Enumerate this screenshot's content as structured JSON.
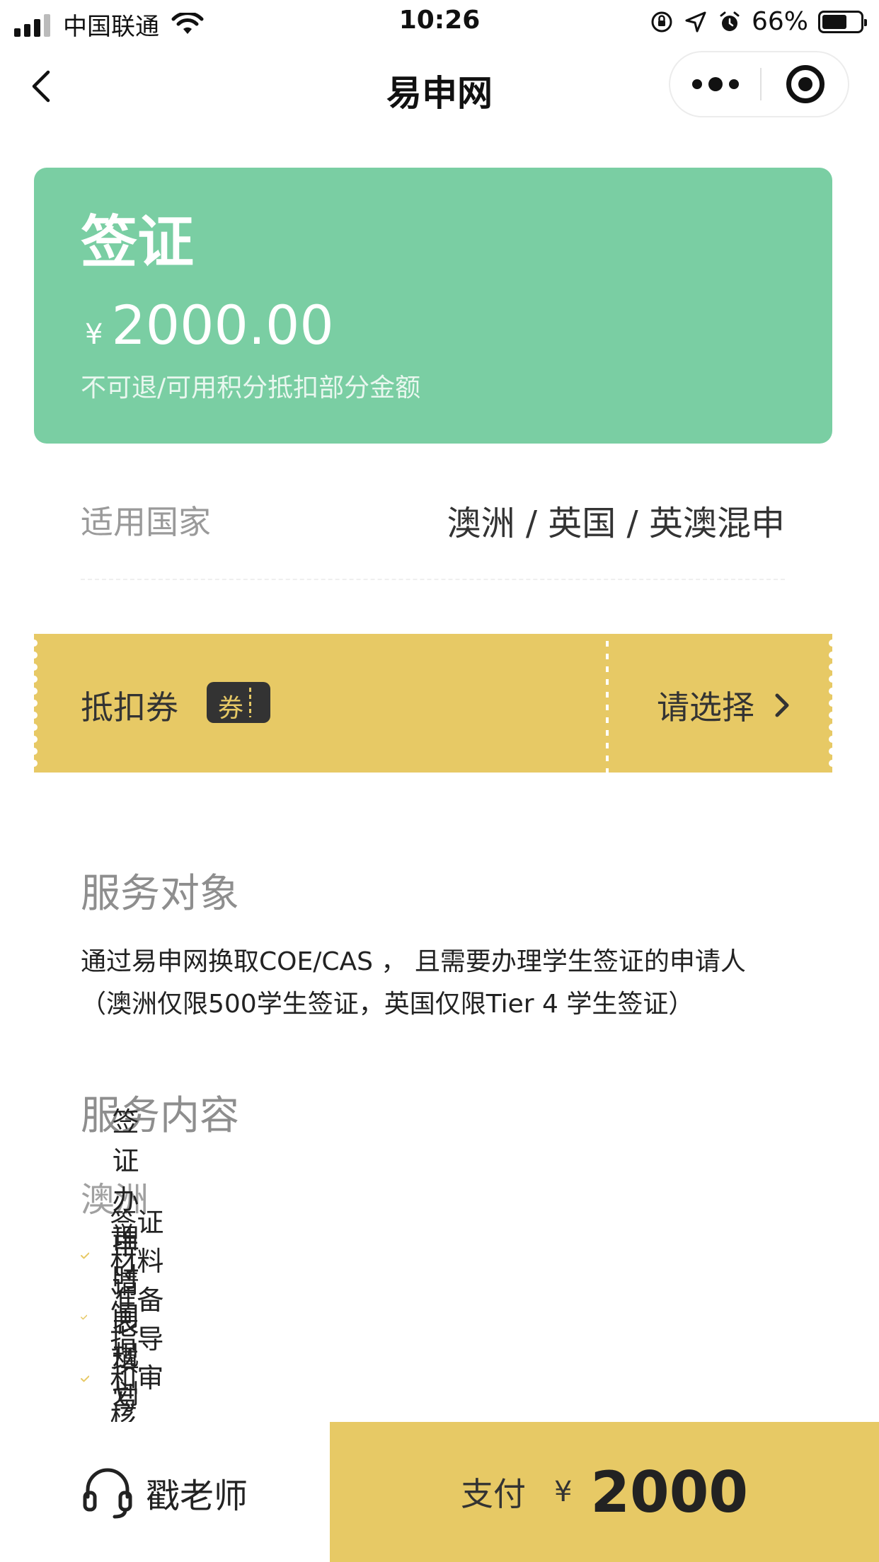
{
  "status_bar": {
    "carrier": "中国联通",
    "time": "10:26",
    "battery_percent": "66%",
    "battery_level": 0.66,
    "icons": [
      "signal-icon",
      "wifi-icon",
      "orientation-lock-icon",
      "location-icon",
      "alarm-icon",
      "battery-icon"
    ]
  },
  "nav": {
    "title": "易申网",
    "icons": [
      "back-arrow-icon",
      "more-dots-icon",
      "mini-program-close-icon"
    ]
  },
  "service": {
    "title": "签证",
    "currency": "¥",
    "price": "2000.00",
    "note": "不可退/可用积分抵扣部分金额",
    "card_color": "#7acea3"
  },
  "countries": {
    "label": "适用国家",
    "value": "澳洲 / 英国 / 英澳混申"
  },
  "coupon": {
    "label": "抵扣券",
    "tag": "券",
    "action": "请选择",
    "color": "#e7c965"
  },
  "audience": {
    "title": "服务对象",
    "line1": "通过易申网换取COE/CAS ，  且需要办理学生签证的申请人",
    "line2": "（澳洲仅限500学生签证，英国仅限Tier 4 学生签证）"
  },
  "content": {
    "title": "服务内容",
    "region": "澳洲",
    "items": [
      "签证办理时间规划",
      "签证材料准备指导和审核",
      "申请表填写和递交"
    ]
  },
  "bottom": {
    "teacher": "戳老师",
    "pay_label": "支付",
    "pay_currency": "¥",
    "pay_amount": "2000"
  }
}
